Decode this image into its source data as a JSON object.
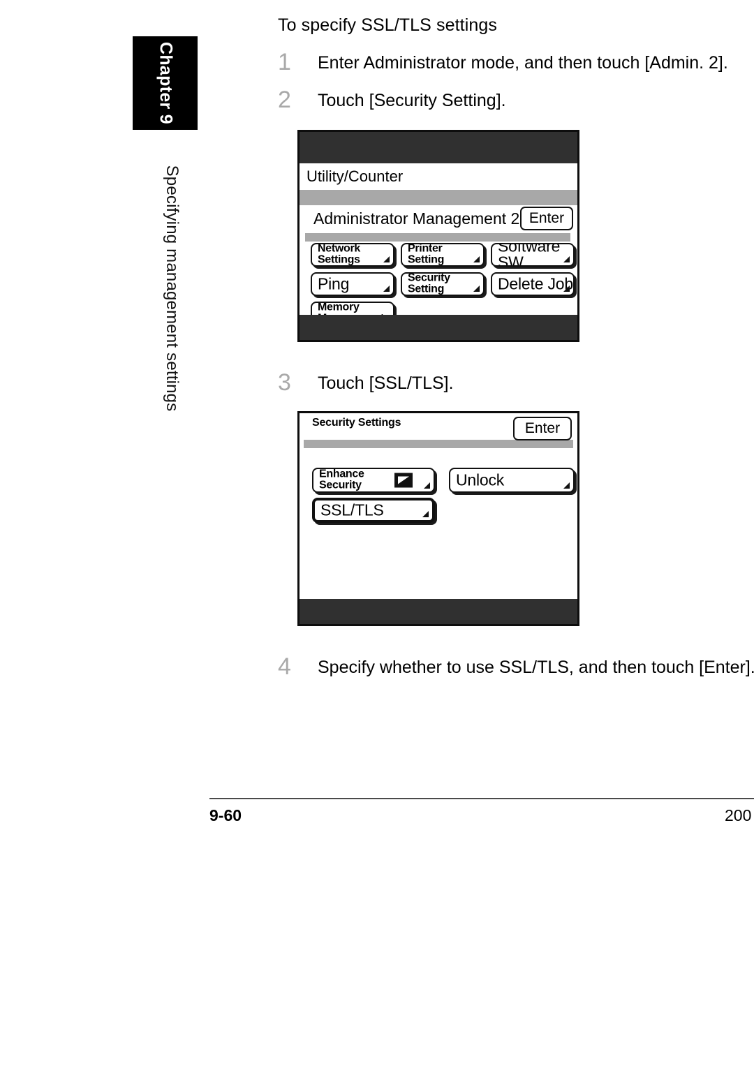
{
  "chapter_tab": {
    "label": "Chapter 9"
  },
  "running_head": {
    "label": "Specifying management settings"
  },
  "section": {
    "heading": "To specify SSL/TLS settings"
  },
  "steps": [
    {
      "number": "1",
      "text": "Enter Administrator mode, and then touch [Admin. 2]."
    },
    {
      "number": "2",
      "text": "Touch [Security Setting]."
    },
    {
      "number": "3",
      "text": "Touch [SSL/TLS]."
    },
    {
      "number": "4",
      "text": "Specify whether to use SSL/TLS, and then touch [Enter]."
    }
  ],
  "panel1": {
    "title_strip": "Utility/Counter",
    "sub_header": "Administrator Management 2",
    "enter_label": "Enter",
    "buttons": [
      {
        "label": "Network\nSettings",
        "size": "small"
      },
      {
        "label": "Printer\nSetting",
        "size": "small"
      },
      {
        "label": "Software SW",
        "size": "big"
      },
      {
        "label": "Ping",
        "size": "big"
      },
      {
        "label": "Security\nSetting",
        "size": "small"
      },
      {
        "label": "Delete Job",
        "size": "big"
      },
      {
        "label": "Memory\nManagement",
        "size": "small"
      }
    ]
  },
  "panel2": {
    "sub_header": "Security\nSettings",
    "enter_label": "Enter",
    "buttons": [
      {
        "label": "Enhance\nSecurity",
        "size": "small",
        "icon": "picture-icon"
      },
      {
        "label": "Unlock",
        "size": "big"
      },
      {
        "label": "SSL/TLS",
        "size": "big",
        "selected": true
      }
    ]
  },
  "footer": {
    "page_number": "9-60",
    "year": "200"
  },
  "colors": {
    "lcd_dark": "#303030",
    "lcd_gray": "#a8a8a8",
    "step_number": "#a9a9a9",
    "ink": "#000000"
  }
}
